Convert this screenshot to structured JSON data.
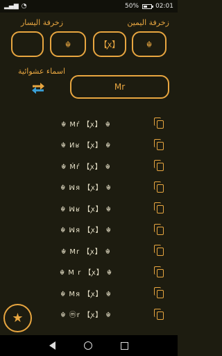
{
  "status_bar": {
    "time": "02:01",
    "battery": "50%",
    "battery_level": 0.5,
    "signal_icon": "signal-icon",
    "wifi_icon": "wifi-icon"
  },
  "decoration": {
    "right_label": "زخرفة اليمين",
    "left_label": "زخرفة اليسار",
    "boxes": [
      "",
      "☬",
      "【ꭗ】",
      "☬"
    ]
  },
  "random": {
    "label": "اسماء عشوائية",
    "swap_icon": "swap-icon"
  },
  "input": {
    "value": "Mr"
  },
  "results": [
    "☬ Mŕ 【ꭗ】 ☬",
    "☬ Иʁ 【ꭗ】 ☬",
    "☬ Ḿŕ 【ꭗ】 ☬",
    "☬ ꟽя 【ꭗ】 ☬",
    "☬ ꟽʁ 【ꭗ】 ☬",
    "☬ ꟽя 【ꭗ】 ☬",
    "☬ Mr 【ꭗ】 ☬",
    "☬ M r 【ꭗ】 ☬",
    "☬ Mя 【ꭗ】 ☬",
    "☬ ⓜr 【ꭗ】 ☬"
  ],
  "fab": {
    "icon": "star-icon",
    "glyph": "★"
  },
  "colors": {
    "accent": "#e8a640",
    "background": "#1d1c10"
  }
}
